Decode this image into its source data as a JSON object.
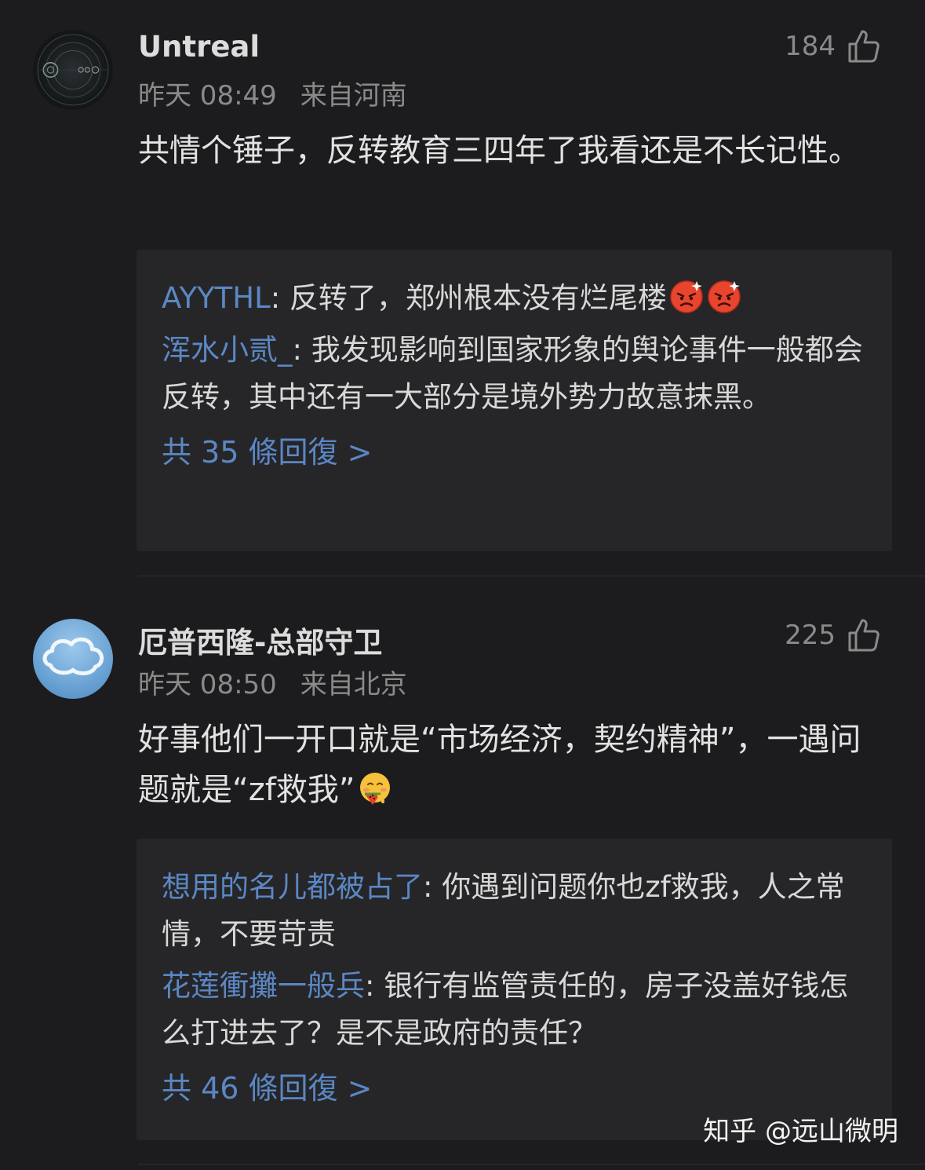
{
  "comments": [
    {
      "username": "Untreal",
      "time": "昨天 08:49",
      "location": "来自河南",
      "likes": "184",
      "content": "共情个锤子，反转教育三四年了我看还是不长记性。",
      "replies": [
        {
          "name": "AYYTHL",
          "text": "反转了，郑州根本没有烂尾楼"
        },
        {
          "name": "浑水小贰_",
          "text": "我发现影响到国家形象的舆论事件一般都会反转，其中还有一大部分是境外势力故意抹黑。"
        }
      ],
      "more_replies": "共 35 條回復 >"
    },
    {
      "username": "厄普西隆-总部守卫",
      "time": "昨天 08:50",
      "location": "来自北京",
      "likes": "225",
      "content": "好事他们一开口就是“市场经济，契约精神”，一遇问题就是“zf救我”",
      "replies": [
        {
          "name": "想用的名儿都被占了",
          "text": "你遇到问题你也zf救我，人之常情，不要苛责"
        },
        {
          "name": "花莲衝攤一般兵",
          "text": "银行有监管责任的，房子没盖好钱怎么打进去了？是不是政府的责任？"
        }
      ],
      "more_replies": "共 46 條回復 >"
    }
  ],
  "watermark": "知乎 @远山微明",
  "icons": {
    "like": "thumbs-up-icon",
    "angry_emoji": "angry-face-emoji-icon",
    "watermelon_emoji": "face-with-watermelon-emoji-icon"
  },
  "colors": {
    "background": "#1c1c1e",
    "reply_box": "#262628",
    "link": "#5b87c4",
    "meta": "#8a8a8a"
  }
}
